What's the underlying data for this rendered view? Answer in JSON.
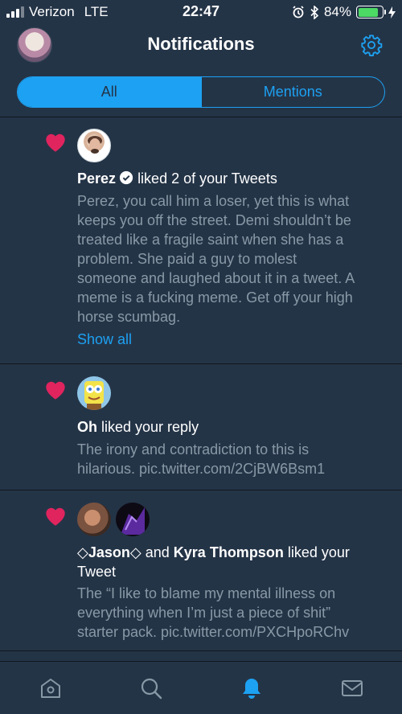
{
  "status_bar": {
    "carrier": "Verizon",
    "network": "LTE",
    "time": "22:47",
    "battery_percent": "84%",
    "battery_level": 0.84
  },
  "header": {
    "title": "Notifications"
  },
  "tabs": {
    "all": "All",
    "mentions": "Mentions"
  },
  "notifications": [
    {
      "user": "Perez",
      "action": "liked 2 of your Tweets",
      "tweet_lines": [
        "Perez, you call him a loser, yet this is what",
        "keeps you off the street. Demi shouldn’t be",
        "treated like a fragile saint when she has a",
        "problem. She paid a guy to molest",
        "someone and laughed about it in a tweet. A",
        "meme is a fucking meme. Get off your high",
        "horse scumbag."
      ],
      "show_all": "Show all"
    },
    {
      "user": "Oh",
      "action": "liked your reply",
      "tweet_lines": [
        "The irony and contradiction to this is",
        "hilarious. pic.twitter.com/2CjBW6Bsm1"
      ]
    },
    {
      "user1": "◇Jason◇",
      "conj": "and",
      "user2": "Kyra Thompson",
      "action": "liked your",
      "action2": "Tweet",
      "tweet_lines": [
        "The “I like to blame my mental illness on",
        "everything when I’m just a piece of shit”",
        "starter pack. pic.twitter.com/PXCHpoRChv"
      ]
    }
  ],
  "colors": {
    "background": "#243447",
    "accent": "#1da1f2",
    "heart": "#e0245e",
    "secondary_text": "#8899a6",
    "battery": "#4cd964"
  },
  "icons": {
    "status": [
      "signal-icon",
      "alarm-icon",
      "bluetooth-icon",
      "battery-icon",
      "charging-icon"
    ],
    "tabbar": [
      "home-icon",
      "search-icon",
      "bell-icon",
      "mail-icon"
    ]
  }
}
